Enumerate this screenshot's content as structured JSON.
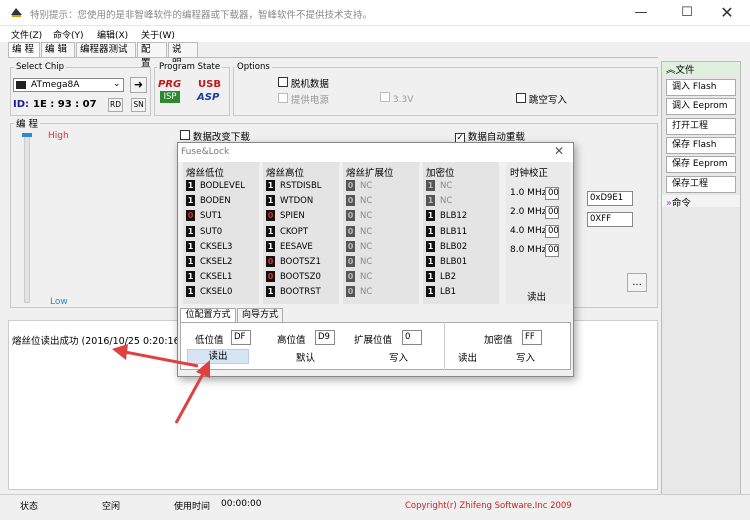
{
  "window": {
    "title": "特别提示：您使用的是非智峰软件的编程器或下载器，智峰软件不提供技术支持。"
  },
  "menu": [
    "文件(Z)",
    "命令(Y)",
    "编辑(X)",
    "关于(W)"
  ],
  "tabs": [
    "编 程",
    "编 辑",
    "编程器测试",
    "配 置",
    "说 明"
  ],
  "select_chip": {
    "label": "Select Chip",
    "chip": "ATmega8A",
    "id_label": "ID:",
    "id_value": "1E : 93 : 07",
    "rd": "RD",
    "sn": "SN"
  },
  "program_state": {
    "label": "Program State",
    "prg": "PRG",
    "isp": "ISP",
    "usb": "USB",
    "asp": "ASP"
  },
  "options": {
    "label": "Options",
    "offline": "脱机数据",
    "power": "提供电源",
    "v33": "3.3V",
    "skip_empty": "跳空写入"
  },
  "prog_group": {
    "label": "编 程",
    "high": "High",
    "low": "Low",
    "changed_download": "数据改变下载",
    "auto_reload": "数据自动重载",
    "auto_reload_checked": true,
    "more": "..."
  },
  "side_panel": {
    "file": "文件",
    "buttons": [
      "调入 Flash",
      "调入 Eeprom",
      "打开工程",
      "保存 Flash",
      "保存 Eeprom",
      "保存工程"
    ],
    "command": "命令"
  },
  "fuse_values_right": [
    "0xD9E1",
    "0XFF"
  ],
  "log": {
    "message": "熔丝位读出成功 (2016/10/25 0:20:16)"
  },
  "status": {
    "state_label": "状态",
    "state_value": "空闲",
    "time_label": "使用时间",
    "time_value": "00:00:00",
    "copyright": "Copyright(r) Zhifeng Software.Inc 2009"
  },
  "dialog": {
    "title": "Fuse&Lock",
    "columns": [
      {
        "header": "熔丝低位",
        "bits": [
          {
            "v": "1",
            "n": "BODLEVEL",
            "s": "on"
          },
          {
            "v": "1",
            "n": "BODEN",
            "s": "on"
          },
          {
            "v": "0",
            "n": "SUT1",
            "s": "red"
          },
          {
            "v": "1",
            "n": "SUT0",
            "s": "on"
          },
          {
            "v": "1",
            "n": "CKSEL3",
            "s": "on"
          },
          {
            "v": "1",
            "n": "CKSEL2",
            "s": "on"
          },
          {
            "v": "1",
            "n": "CKSEL1",
            "s": "on"
          },
          {
            "v": "1",
            "n": "CKSEL0",
            "s": "on"
          }
        ]
      },
      {
        "header": "熔丝高位",
        "bits": [
          {
            "v": "1",
            "n": "RSTDISBL",
            "s": "on"
          },
          {
            "v": "1",
            "n": "WTDON",
            "s": "on"
          },
          {
            "v": "0",
            "n": "SPIEN",
            "s": "red"
          },
          {
            "v": "1",
            "n": "CKOPT",
            "s": "on"
          },
          {
            "v": "1",
            "n": "EESAVE",
            "s": "on"
          },
          {
            "v": "0",
            "n": "BOOTSZ1",
            "s": "red"
          },
          {
            "v": "0",
            "n": "BOOTSZ0",
            "s": "red"
          },
          {
            "v": "1",
            "n": "BOOTRST",
            "s": "on"
          }
        ]
      },
      {
        "header": "熔丝扩展位",
        "bits": [
          {
            "v": "0",
            "n": "NC",
            "s": "na"
          },
          {
            "v": "0",
            "n": "NC",
            "s": "na"
          },
          {
            "v": "0",
            "n": "NC",
            "s": "na"
          },
          {
            "v": "0",
            "n": "NC",
            "s": "na"
          },
          {
            "v": "0",
            "n": "NC",
            "s": "na"
          },
          {
            "v": "0",
            "n": "NC",
            "s": "na"
          },
          {
            "v": "0",
            "n": "NC",
            "s": "na"
          },
          {
            "v": "0",
            "n": "NC",
            "s": "na"
          }
        ]
      },
      {
        "header": "加密位",
        "bits": [
          {
            "v": "1",
            "n": "NC",
            "s": "na"
          },
          {
            "v": "1",
            "n": "NC",
            "s": "na"
          },
          {
            "v": "1",
            "n": "BLB12",
            "s": "on"
          },
          {
            "v": "1",
            "n": "BLB11",
            "s": "on"
          },
          {
            "v": "1",
            "n": "BLB02",
            "s": "on"
          },
          {
            "v": "1",
            "n": "BLB01",
            "s": "on"
          },
          {
            "v": "1",
            "n": "LB2",
            "s": "on"
          },
          {
            "v": "1",
            "n": "LB1",
            "s": "on"
          }
        ]
      }
    ],
    "clock": {
      "header": "时钟校正",
      "rows": [
        {
          "f": "1.0 MHz",
          "v": "00"
        },
        {
          "f": "2.0 MHz",
          "v": "00"
        },
        {
          "f": "4.0 MHz",
          "v": "00"
        },
        {
          "f": "8.0 MHz",
          "v": "00"
        }
      ],
      "read": "读出"
    },
    "tabs": [
      "位配置方式",
      "向导方式"
    ],
    "low_label": "低位值",
    "low_value": "DF",
    "high_label": "高位值",
    "high_value": "D9",
    "ext_label": "扩展位值",
    "ext_value": "0",
    "lock_label": "加密值",
    "lock_value": "FF",
    "read": "读出",
    "default": "默认",
    "write": "写入",
    "lock_read": "读出",
    "lock_write": "写入"
  },
  "colors": {
    "arrow": "#e04040",
    "high": "#e03030",
    "low": "#2a8ad4",
    "copyright": "#cc2020",
    "side_header": "#dff0df"
  }
}
